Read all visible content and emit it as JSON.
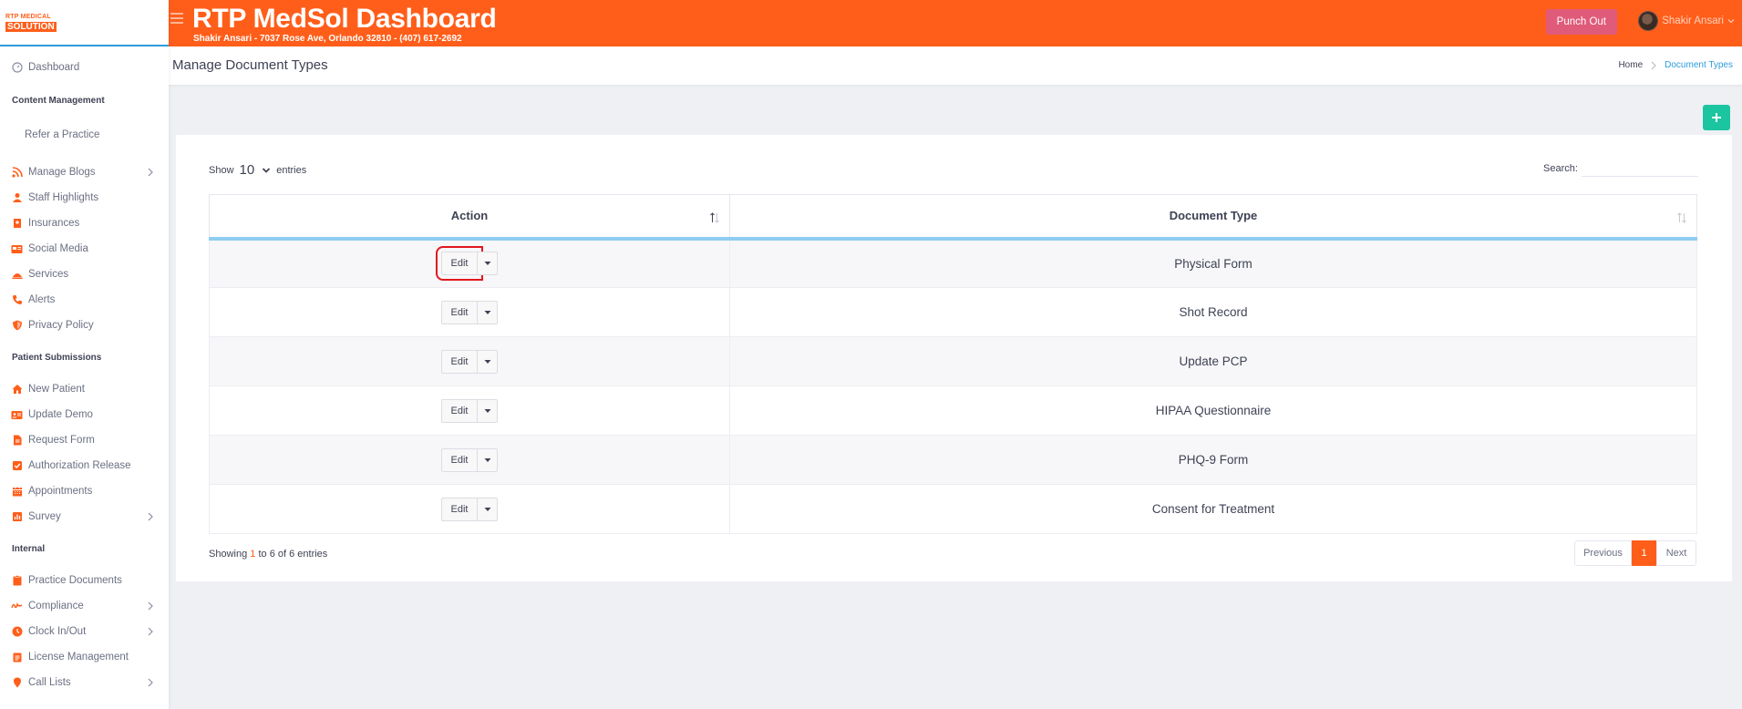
{
  "logo": {
    "line1": "RTP MEDICAL",
    "line2": "SOLUTION"
  },
  "header": {
    "title": "RTP MedSol Dashboard",
    "subtitle": "Shakir Ansari - 7037 Rose Ave, Orlando 32810 - (407) 617-2692",
    "punch_label": "Punch Out",
    "user_name": "Shakir Ansari"
  },
  "sidebar": {
    "dashboard": "Dashboard",
    "sections": {
      "content": "Content Management",
      "patient": "Patient Submissions",
      "internal": "Internal"
    },
    "refer": "Refer a Practice",
    "content_items": [
      "Manage Blogs",
      "Staff Highlights",
      "Insurances",
      "Social Media",
      "Services",
      "Alerts",
      "Privacy Policy"
    ],
    "patient_items": [
      "New Patient",
      "Update Demo",
      "Request Form",
      "Authorization Release",
      "Appointments",
      "Survey"
    ],
    "internal_items": [
      "Practice Documents",
      "Compliance",
      "Clock In/Out",
      "License Management",
      "Call Lists"
    ]
  },
  "page": {
    "title": "Manage Document Types",
    "breadcrumb_home": "Home",
    "breadcrumb_current": "Document Types",
    "add_icon": "plus-icon"
  },
  "table_controls": {
    "show_label": "Show",
    "entries_value": "10",
    "entries_label": "entries",
    "search_label": "Search:"
  },
  "table": {
    "headers": {
      "action": "Action",
      "document_type": "Document Type"
    },
    "edit_label": "Edit",
    "rows": [
      {
        "document_type": "Physical Form"
      },
      {
        "document_type": "Shot Record"
      },
      {
        "document_type": "Update PCP"
      },
      {
        "document_type": "HIPAA Questionnaire"
      },
      {
        "document_type": "PHQ-9 Form"
      },
      {
        "document_type": "Consent for Treatment"
      }
    ]
  },
  "footer": {
    "showing_prefix": "Showing ",
    "from": "1",
    "to_word": " to ",
    "to": "6",
    "of_text": " of 6 entries",
    "prev": "Previous",
    "current_page": "1",
    "next": "Next"
  },
  "colors": {
    "brand": "#ff5e1a",
    "accent_blue": "#2d9cdb",
    "add": "#1bc5a0",
    "punch": "#e05a7a"
  }
}
